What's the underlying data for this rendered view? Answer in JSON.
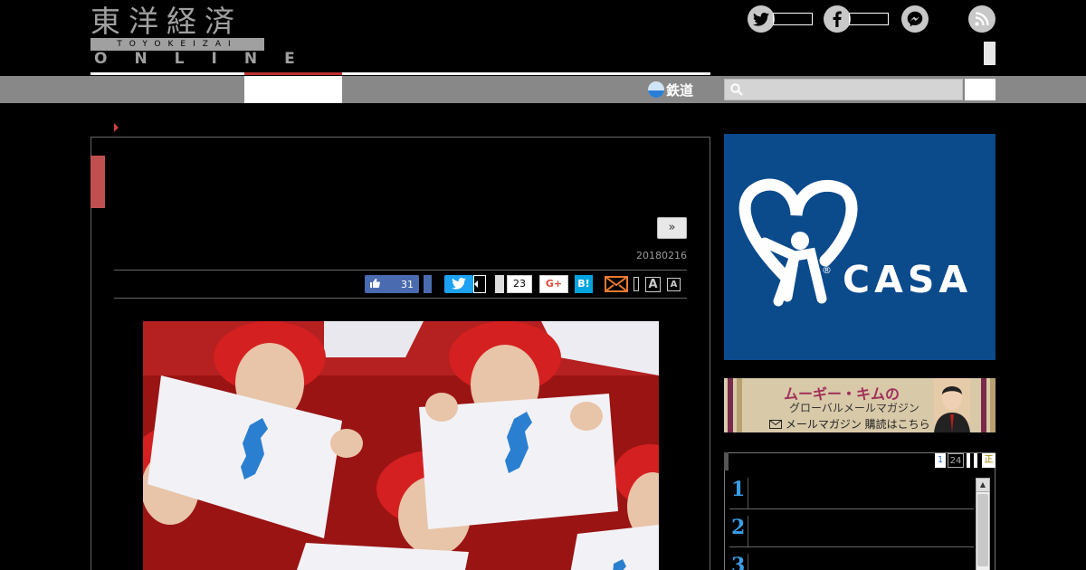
{
  "header": {
    "logo_kanji": "東洋経済",
    "logo_roman": "TOYOKEIZAI",
    "logo_online": "ONLINE",
    "social_icons": [
      "twitter-icon",
      "facebook-icon",
      "messenger-icon",
      "rss-icon"
    ]
  },
  "nav": {
    "rail_label": "鉄道",
    "search_placeholder": ""
  },
  "article": {
    "next_label": "»",
    "date": "20180216",
    "share": {
      "like_count": "31",
      "facebook_count": "23",
      "gplus_label": "G+",
      "hatena_label": "B!",
      "font_large": "A",
      "font_small": "A"
    }
  },
  "sidebar": {
    "ad_casa": {
      "brand": "CASA",
      "reg": "®",
      "color": "#0b4a8b"
    },
    "ad_magazine": {
      "title": "ムーギー・キムの",
      "subtitle": "グローバルメールマガジン",
      "footer": "メールマガジン 購読はこちら"
    },
    "ranking": {
      "tabs": [
        "1",
        "24",
        "",
        "",
        "正"
      ],
      "numbers": [
        "1",
        "2",
        "3"
      ],
      "rank_color": "#3a9ee8"
    }
  },
  "colors": {
    "accent_red": "#c05050",
    "nav_gray": "#888888",
    "twitter_blue": "#1da1f2",
    "facebook_blue": "#4a6bb0"
  }
}
